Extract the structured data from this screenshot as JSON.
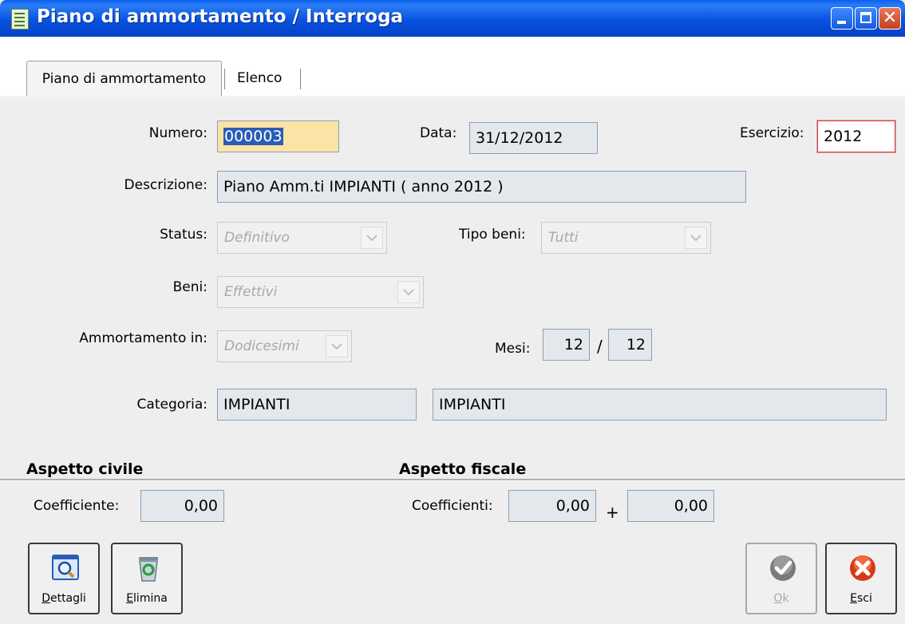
{
  "window": {
    "title": "Piano di ammortamento / Interroga"
  },
  "tabs": [
    {
      "label": "Piano di ammortamento"
    },
    {
      "label": "Elenco"
    }
  ],
  "form": {
    "numero_label": "Numero:",
    "numero_value": "000003",
    "data_label": "Data:",
    "data_value": "31/12/2012",
    "esercizio_label": "Esercizio:",
    "esercizio_value": "2012",
    "descrizione_label": "Descrizione:",
    "descrizione_value": "Piano Amm.ti IMPIANTI  ( anno 2012 )",
    "status_label": "Status:",
    "status_value": "Definitivo",
    "tipo_beni_label": "Tipo beni:",
    "tipo_beni_value": "Tutti",
    "beni_label": "Beni:",
    "beni_value": "Effettivi",
    "ammortamento_label": "Ammortamento in:",
    "ammortamento_value": "Dodicesimi",
    "mesi_label": "Mesi:",
    "mesi_value1": "12",
    "mesi_sep": "/",
    "mesi_value2": "12",
    "categoria_label": "Categoria:",
    "categoria_code": "IMPIANTI",
    "categoria_desc": "IMPIANTI"
  },
  "civile": {
    "header": "Aspetto civile",
    "coeff_label": "Coefficiente:",
    "coeff_value": "0,00"
  },
  "fiscale": {
    "header": "Aspetto fiscale",
    "coeff_label": "Coefficienti:",
    "coeff_value1": "0,00",
    "plus": "+",
    "coeff_value2": "0,00"
  },
  "buttons": {
    "dettagli_key": "D",
    "dettagli_rest": "ettagli",
    "elimina_key": "E",
    "elimina_rest": "limina",
    "ok_key": "O",
    "ok_rest": "k",
    "esci_key": "E",
    "esci_rest": "sci"
  },
  "colors": {
    "titlebar": "#0852e0",
    "field_bg": "#e4e8ec",
    "highlight_field": "#fbe3a6",
    "close_button": "#c6401c"
  }
}
